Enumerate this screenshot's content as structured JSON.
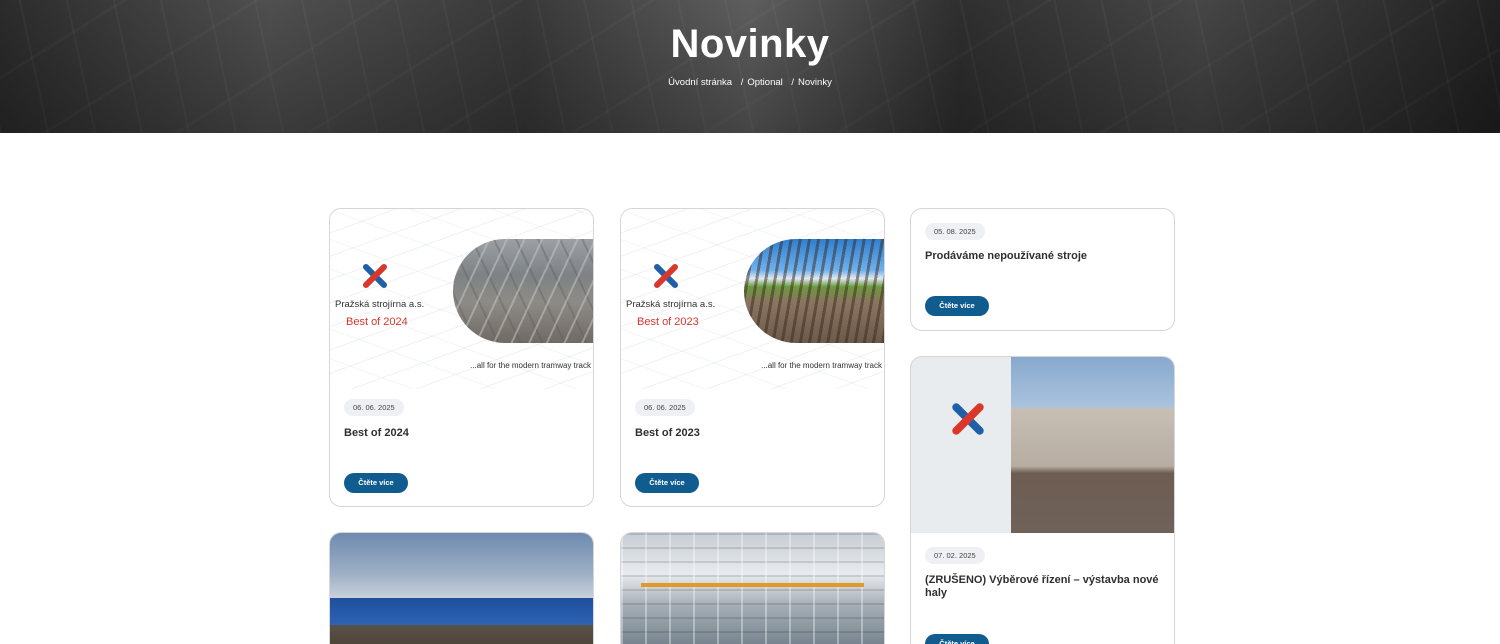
{
  "hero": {
    "title": "Novinky",
    "breadcrumb": [
      "Úvodní stránka",
      "Optional",
      "Novinky"
    ],
    "separator": "/"
  },
  "colors": {
    "accent": "#105c8f",
    "promo_red": "#d9372c"
  },
  "cards": [
    {
      "image": {
        "type": "promo",
        "company": "Pražská strojírna a.s.",
        "headline": "Best of 2024",
        "tagline": "...all for the modern tramway track"
      },
      "date": "06. 06. 2025",
      "title": "Best of 2024",
      "button": "Čtěte více"
    },
    {
      "image": {
        "type": "promo",
        "company": "Pražská strojírna a.s.",
        "headline": "Best of 2023",
        "tagline": "...all for the modern tramway track"
      },
      "date": "06. 06. 2025",
      "title": "Best of 2023",
      "button": "Čtěte více"
    },
    {
      "date": "05. 08. 2025",
      "title": "Prodáváme nepoužívané stroje",
      "button": "Čtěte více"
    },
    {
      "image": {
        "type": "photo"
      },
      "date": "07. 02. 2025",
      "title": "(ZRUŠENO) Výběrové řízení – výstavba nové haly",
      "button": "Čtěte více"
    },
    {
      "image": {
        "type": "photo"
      }
    },
    {
      "image": {
        "type": "photo"
      }
    }
  ]
}
